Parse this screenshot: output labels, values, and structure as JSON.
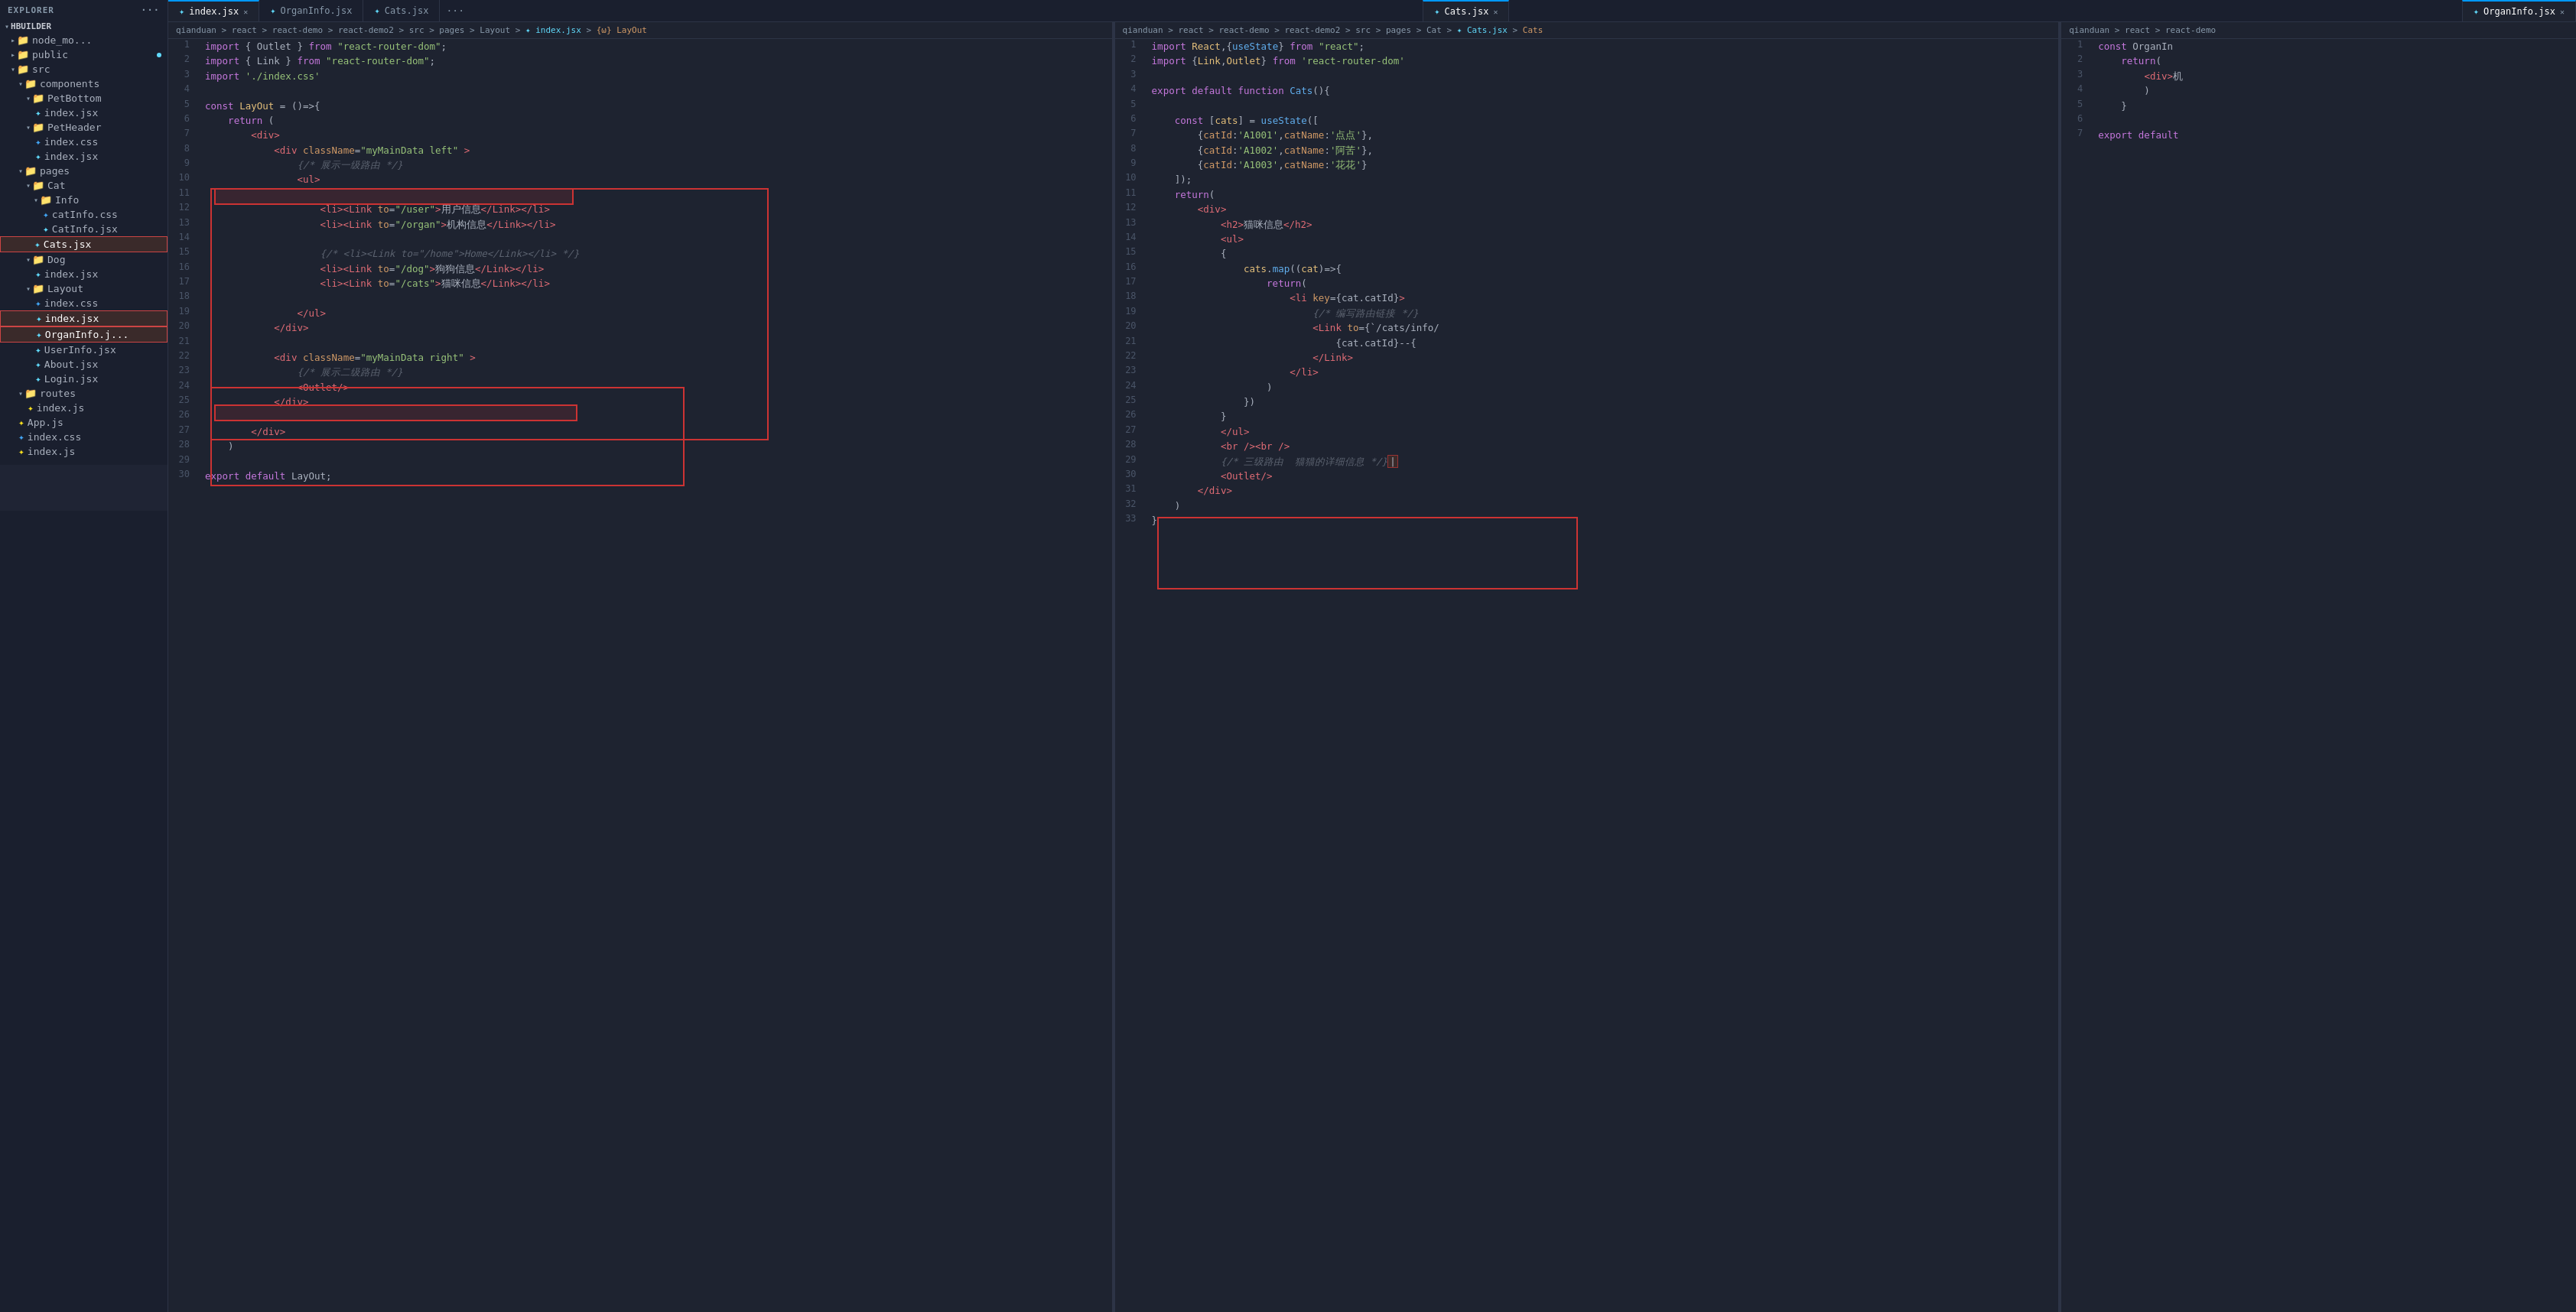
{
  "sidebar": {
    "header": "EXPLORER",
    "root": "HBUILDER",
    "tree": [
      {
        "id": "node_modu",
        "label": "node_mo...",
        "type": "folder",
        "indent": 1,
        "open": true
      },
      {
        "id": "public",
        "label": "public",
        "type": "folder",
        "indent": 1,
        "open": false,
        "badge": true
      },
      {
        "id": "src",
        "label": "src",
        "type": "folder",
        "indent": 1,
        "open": true
      },
      {
        "id": "components",
        "label": "components",
        "type": "folder",
        "indent": 2,
        "open": true
      },
      {
        "id": "PetBottom",
        "label": "PetBottom",
        "type": "folder",
        "indent": 3,
        "open": true
      },
      {
        "id": "PetBottom_index",
        "label": "index.jsx",
        "type": "jsx",
        "indent": 4
      },
      {
        "id": "PetHeader",
        "label": "PetHeader",
        "type": "folder",
        "indent": 3,
        "open": true
      },
      {
        "id": "PetHeader_css",
        "label": "index.css",
        "type": "css",
        "indent": 4
      },
      {
        "id": "PetHeader_jsx",
        "label": "index.jsx",
        "type": "jsx",
        "indent": 4
      },
      {
        "id": "pages",
        "label": "pages",
        "type": "folder",
        "indent": 2,
        "open": true
      },
      {
        "id": "Cat",
        "label": "Cat",
        "type": "folder",
        "indent": 3,
        "open": true
      },
      {
        "id": "Info",
        "label": "Info",
        "type": "folder",
        "indent": 4,
        "open": true
      },
      {
        "id": "catInfo_css",
        "label": "catInfo.css",
        "type": "css",
        "indent": 5
      },
      {
        "id": "CatInfo_jsx",
        "label": "CatInfo.jsx",
        "type": "jsx",
        "indent": 5
      },
      {
        "id": "Cats_jsx",
        "label": "Cats.jsx",
        "type": "jsx",
        "indent": 4,
        "selected": true
      },
      {
        "id": "Dog",
        "label": "Dog",
        "type": "folder",
        "indent": 3,
        "open": true
      },
      {
        "id": "Dog_index",
        "label": "index.jsx",
        "type": "jsx",
        "indent": 4
      },
      {
        "id": "Layout",
        "label": "Layout",
        "type": "folder",
        "indent": 3,
        "open": true
      },
      {
        "id": "Layout_css",
        "label": "index.css",
        "type": "css",
        "indent": 4
      },
      {
        "id": "Layout_index",
        "label": "index.jsx",
        "type": "jsx",
        "indent": 4,
        "selected": true
      },
      {
        "id": "OrganInfo",
        "label": "OrganInfo.j...",
        "type": "jsx",
        "indent": 4,
        "selected": true
      },
      {
        "id": "UserInfo",
        "label": "UserInfo.jsx",
        "type": "jsx",
        "indent": 4
      },
      {
        "id": "About",
        "label": "About.jsx",
        "type": "jsx",
        "indent": 4
      },
      {
        "id": "Login",
        "label": "Login.jsx",
        "type": "jsx",
        "indent": 4
      },
      {
        "id": "routes",
        "label": "routes",
        "type": "folder",
        "indent": 2,
        "open": true
      },
      {
        "id": "routes_index",
        "label": "index.js",
        "type": "js",
        "indent": 3
      },
      {
        "id": "App_js",
        "label": "App.js",
        "type": "js",
        "indent": 2
      },
      {
        "id": "index_css",
        "label": "index.css",
        "type": "css",
        "indent": 2
      },
      {
        "id": "index_js",
        "label": "index.js",
        "type": "js",
        "indent": 2
      }
    ]
  },
  "tabs": {
    "pane1": [
      {
        "label": "index.jsx",
        "type": "jsx",
        "active": true,
        "closable": true
      },
      {
        "label": "OrganInfo.jsx",
        "type": "jsx",
        "active": false,
        "closable": false
      },
      {
        "label": "Cats.jsx",
        "type": "jsx",
        "active": false,
        "closable": false
      }
    ],
    "pane2": [
      {
        "label": "Cats.jsx",
        "type": "jsx",
        "active": true,
        "closable": true
      }
    ],
    "pane3": [
      {
        "label": "OrganInfo.jsx",
        "type": "jsx",
        "active": true,
        "closable": true
      }
    ]
  },
  "breadcrumbs": {
    "pane1": "qianduan > react > react-demo > react-demo2 > src > pages > Layout > index.jsx > {ω} LayOut",
    "pane2": "qianduan > react > react-demo > react-demo2 > src > pages > Cat > Cats.jsx > Cats",
    "pane3": "qianduan > react > react-demo > react-demo"
  },
  "code": {
    "pane1": [
      {
        "n": 1,
        "t": "import_line",
        "code": "  't { Outlet } from \"react-router-dom\";"
      },
      {
        "n": 2,
        "t": "import_line",
        "code": "  't { Link } from \"react-router-dom\";"
      },
      {
        "n": 3,
        "t": "import_line",
        "code": "  't './index.css'"
      },
      {
        "n": 4,
        "t": "blank"
      },
      {
        "n": 5,
        "t": "code",
        "code": "  : LayOut = ()=>{"
      },
      {
        "n": 6,
        "t": "code",
        "code": "    return ("
      },
      {
        "n": 7,
        "t": "code",
        "code": "        <div>"
      },
      {
        "n": 8,
        "t": "code",
        "code": "            <div className=\"myMainData left\" >"
      },
      {
        "n": 9,
        "t": "code",
        "code": "                {/* 展示一级路由 */}"
      },
      {
        "n": 10,
        "t": "code",
        "code": "                <ul>"
      },
      {
        "n": 11,
        "t": "blank"
      },
      {
        "n": 12,
        "t": "code",
        "code": "                    <li><Link to=\"/user\">用户信息</Link></li>"
      },
      {
        "n": 13,
        "t": "code",
        "code": "                    <li><Link to=\"/organ\">机构信息</Link></li>"
      },
      {
        "n": 14,
        "t": "blank"
      },
      {
        "n": 15,
        "t": "code",
        "code": "                    {/* <li><Link to=\"/home\">Home</Link></li> */}"
      },
      {
        "n": 16,
        "t": "code",
        "code": "                    <li><Link to=\"/dog\">狗狗信息</Link></li>"
      },
      {
        "n": 17,
        "t": "code",
        "code": "                    <li><Link to=\"/cats\">猫咪信息</Link></li>"
      },
      {
        "n": 18,
        "t": "blank"
      },
      {
        "n": 19,
        "t": "code",
        "code": "                </ul>"
      },
      {
        "n": 20,
        "t": "code",
        "code": "            </div>"
      },
      {
        "n": 21,
        "t": "blank"
      },
      {
        "n": 22,
        "t": "code",
        "code": "            <div className=\"myMainData right\" >"
      },
      {
        "n": 23,
        "t": "code",
        "code": "                {/* 展示二级路由 */}"
      },
      {
        "n": 24,
        "t": "code",
        "code": "                <Outlet/>"
      },
      {
        "n": 25,
        "t": "code",
        "code": "            </div>"
      },
      {
        "n": 26,
        "t": "blank"
      },
      {
        "n": 27,
        "t": "code",
        "code": "        </div>"
      },
      {
        "n": 28,
        "t": "code",
        "code": "    )"
      },
      {
        "n": 29,
        "t": "blank"
      },
      {
        "n": 30,
        "t": "code",
        "code": "  t default LayOut;"
      }
    ],
    "pane2": [
      {
        "n": 1,
        "code": "import React,{useState} from \"react\";"
      },
      {
        "n": 2,
        "code": "import {Link,Outlet} from 'react-router-dom'"
      },
      {
        "n": 3,
        "code": ""
      },
      {
        "n": 4,
        "code": "export default function Cats(){"
      },
      {
        "n": 5,
        "code": ""
      },
      {
        "n": 6,
        "code": "    const [cats] = useState(["
      },
      {
        "n": 7,
        "code": "        {catId:'A1001',catName:'点点'},"
      },
      {
        "n": 8,
        "code": "        {catId:'A1002',catName:'阿苦'},"
      },
      {
        "n": 9,
        "code": "        {catId:'A1003',catName:'花花'}"
      },
      {
        "n": 10,
        "code": "    ]);"
      },
      {
        "n": 11,
        "code": "    return("
      },
      {
        "n": 12,
        "code": "        <div>"
      },
      {
        "n": 13,
        "code": "            <h2>猫咪信息</h2>"
      },
      {
        "n": 14,
        "code": "            <ul>"
      },
      {
        "n": 15,
        "code": "            {"
      },
      {
        "n": 16,
        "code": "                cats.map((cat)=>{"
      },
      {
        "n": 17,
        "code": "                    return("
      },
      {
        "n": 18,
        "code": "                        <li key={cat.catId}>"
      },
      {
        "n": 19,
        "code": "                            {/* 编写路由链接 */}"
      },
      {
        "n": 20,
        "code": "                            <Link to={`/cats/info/"
      },
      {
        "n": 21,
        "code": "                                {cat.catId}--{"
      },
      {
        "n": 22,
        "code": "                            </Link>"
      },
      {
        "n": 23,
        "code": "                        </li>"
      },
      {
        "n": 24,
        "code": "                    )"
      },
      {
        "n": 25,
        "code": "                })"
      },
      {
        "n": 26,
        "code": "            }"
      },
      {
        "n": 27,
        "code": "            </ul>"
      },
      {
        "n": 28,
        "code": "            <br /><br />"
      },
      {
        "n": 29,
        "code": "            {/* 三级路由  猫猫的详细信息 */}"
      },
      {
        "n": 30,
        "code": "            <Outlet/>"
      },
      {
        "n": 31,
        "code": "        </div>"
      },
      {
        "n": 32,
        "code": "    )"
      },
      {
        "n": 33,
        "code": "}"
      }
    ],
    "pane3": [
      {
        "n": 1,
        "code": "const OrganIn"
      },
      {
        "n": 2,
        "code": "    return("
      },
      {
        "n": 3,
        "code": "        <div>机"
      },
      {
        "n": 4,
        "code": "        )"
      },
      {
        "n": 5,
        "code": "    }"
      },
      {
        "n": 6,
        "code": ""
      },
      {
        "n": 7,
        "code": "export default"
      }
    ]
  },
  "colors": {
    "bg": "#1e2330",
    "sidebar_bg": "#1a1f2e",
    "tab_active_border": "#0098ff",
    "annotation_red": "#cc3333",
    "keyword": "#c678dd",
    "string": "#98c379",
    "function": "#61afef",
    "tag": "#e06c75",
    "attr": "#d19a66",
    "comment": "#5c6370",
    "variable": "#e5c07b"
  }
}
